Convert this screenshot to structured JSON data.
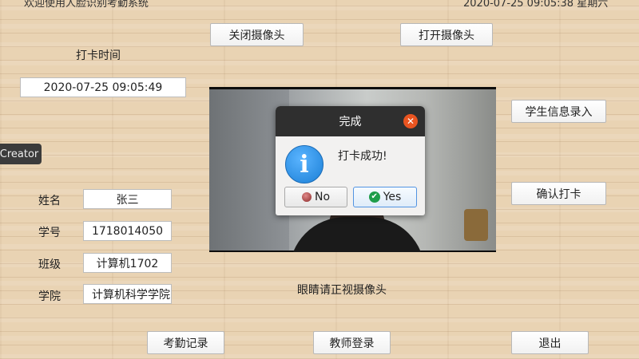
{
  "header": {
    "app_title": "欢迎使用人脸识别考勤系统",
    "datetime": "2020-07-25 09:05:38 星期六"
  },
  "buttons": {
    "close_camera": "关闭摄像头",
    "open_camera": "打开摄像头",
    "student_entry": "学生信息录入",
    "confirm_checkin": "确认打卡",
    "attendance_record": "考勤记录",
    "teacher_login": "教师登录",
    "exit": "退出"
  },
  "checkin": {
    "label": "打卡时间",
    "time_value": "2020-07-25 09:05:49"
  },
  "creator_tab": "Creator",
  "student": {
    "name_label": "姓名",
    "name_value": "张三",
    "id_label": "学号",
    "id_value": "1718014050",
    "class_label": "班级",
    "class_value": "计算机1702",
    "college_label": "学院",
    "college_value": "计算机科学学院"
  },
  "hint": "眼睛请正视摄像头",
  "dialog": {
    "title": "完成",
    "message": "打卡成功!",
    "no_label": "No",
    "yes_label": "Yes",
    "info_icon": "info-icon",
    "close_icon": "close-icon"
  },
  "colors": {
    "accent_close": "#e95420",
    "info_blue": "#1b7fd6",
    "title_bar": "#2f2f2f"
  }
}
